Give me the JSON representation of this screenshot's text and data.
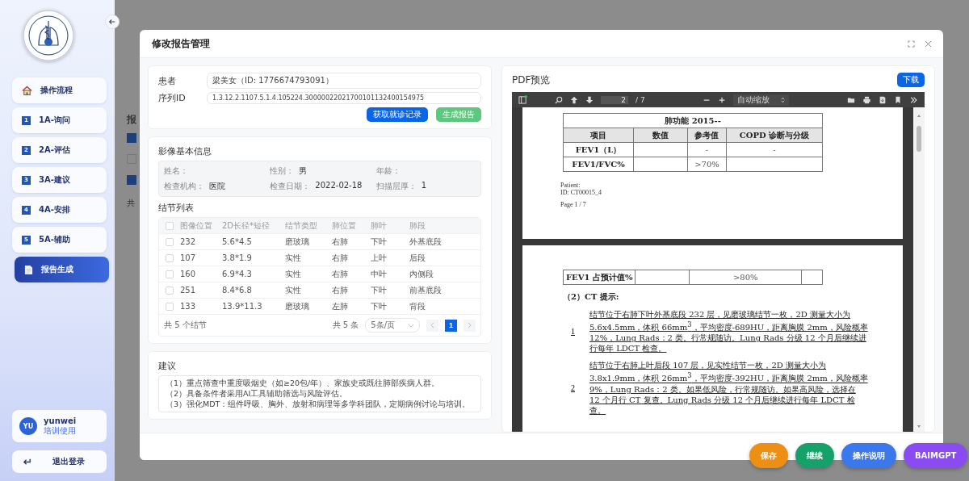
{
  "sidebar": {
    "nav": [
      {
        "kind": "home",
        "label": "操作流程",
        "selected": false
      },
      {
        "kind": "step",
        "badge": "1",
        "label": "1A-询问",
        "selected": false
      },
      {
        "kind": "step",
        "badge": "2",
        "label": "2A-评估",
        "selected": false
      },
      {
        "kind": "step",
        "badge": "3",
        "label": "3A-建议",
        "selected": false
      },
      {
        "kind": "step",
        "badge": "4",
        "label": "4A-安排",
        "selected": false
      },
      {
        "kind": "step",
        "badge": "5",
        "label": "5A-辅助",
        "selected": false
      },
      {
        "kind": "doc",
        "label": "报告生成",
        "selected": true
      }
    ],
    "user": {
      "avatar": "YU",
      "name": "yunwei",
      "role": "培训使用"
    },
    "logout": "退出登录"
  },
  "background": {
    "heading": "报",
    "footer": "共",
    "checkboxes": [
      {
        "checked": true
      },
      {
        "checked": false
      },
      {
        "checked": true
      }
    ]
  },
  "modal": {
    "title": "修改报告管理",
    "patient": {
      "label": "患者",
      "value": "梁美女（ID: 1776674793091）"
    },
    "series": {
      "label": "序列ID",
      "value": "1.3.12.2.1107.5.1.4.105224.30000022021700101132400154975"
    },
    "actions": [
      {
        "kind": "primary",
        "label": "获取就诊记录"
      },
      {
        "kind": "success",
        "label": "生成报告"
      }
    ],
    "image_info": {
      "title": "影像基本信息",
      "fields": [
        {
          "label": "姓名："
        },
        {
          "label": "性别：",
          "value": "男"
        },
        {
          "label": "年龄："
        },
        {
          "label": "检查机构：",
          "value": "医院"
        },
        {
          "label": "检查日期：",
          "value": "2022-02-18"
        },
        {
          "label": "扫描层厚：",
          "value": "1"
        }
      ]
    },
    "nodules": {
      "title": "结节列表",
      "header_checked": false,
      "columns": [
        "图像位置",
        "2D长径*短径",
        "结节类型",
        "肺位置",
        "肺叶",
        "肺段"
      ],
      "rows": [
        {
          "checked": false,
          "cells": [
            "232",
            "5.6*4.5",
            "磨玻璃",
            "右肺",
            "下叶",
            "外基底段"
          ]
        },
        {
          "checked": false,
          "cells": [
            "107",
            "3.8*1.9",
            "实性",
            "右肺",
            "上叶",
            "后段"
          ]
        },
        {
          "checked": false,
          "cells": [
            "160",
            "6.9*4.3",
            "实性",
            "右肺",
            "中叶",
            "内侧段"
          ]
        },
        {
          "checked": false,
          "cells": [
            "251",
            "8.4*6.8",
            "实性",
            "右肺",
            "下叶",
            "前基底段"
          ]
        },
        {
          "checked": false,
          "cells": [
            "133",
            "13.9*11.3",
            "磨玻璃",
            "左肺",
            "下叶",
            "背段"
          ]
        }
      ],
      "summary": "共 5 个结节",
      "total": "共 5 条",
      "page_size": "5条/页",
      "pages": [
        {
          "label": "1",
          "selected": true
        }
      ]
    },
    "advice": {
      "title": "建议",
      "lines": [
        "（1）重点筛查中重度吸烟史（如≥20包/年）、家族史或既往肺部疾病人群。",
        "（2）具备条件者采用AI工具辅助筛选与风险评估。",
        "（3）强化MDT：组件呼吸、胸外、放射和病理等多学科团队，定期病例讨论与培训。"
      ]
    },
    "pdf": {
      "title": "PDF预览",
      "download": "下载",
      "page_input": "2",
      "page_count": "/ 7",
      "zoom": "自动缩放",
      "page1": {
        "table_title": "肺功能 2015--",
        "headers": [
          "项目",
          "数值",
          "参考值",
          "COPD 诊断与分级"
        ],
        "rows": [
          [
            "FEV1（L）",
            null,
            "-",
            "-"
          ],
          [
            "FEV1/FVC%",
            null,
            ">70%",
            null
          ]
        ],
        "footer": [
          "Patient:",
          "ID: CT00015_4"
        ],
        "page_label": "Page 1 / 7"
      },
      "page2": {
        "rows": [
          [
            "FEV1 占预计值%",
            null,
            ">80%",
            null
          ]
        ],
        "heading": "（2）CT 提示:",
        "items": [
          {
            "num": "1",
            "text": "结节位于右肺下叶外基底段 232 层，见磨玻璃结节一枚，2D 测量大小为 5.6x4.5mm，体积 66mm$^{3}$，平均密度-689HU，距离胸膜 2mm，风险概率 12%，Lung Rads：2 类。行常规随访。Lung Rads 分级 12 个月后继续进行每年 LDCT 检查。"
          },
          {
            "num": "2",
            "text": "结节位于右肺上叶后段 107 层，见实性结节一枚，2D 测量大小为 3.8x1.9mm，体积 26mm$^{3}$，平均密度-392HU，距离胸膜 2mm，风险概率 9%，Lung Rads：2 类。如果低风险，行常规随访。如果高风险，选择在 12 个月行 CT 复查。Lung Rads 分级 12 个月后继续进行每年 LDCT 检查。"
          }
        ]
      }
    }
  },
  "floating_buttons": [
    {
      "label": "保存",
      "color": "#ec8f14"
    },
    {
      "label": "继续",
      "color": "#16a06a"
    },
    {
      "label": "操作说明",
      "color": "#3a78ec"
    },
    {
      "label": "BAIMGPT",
      "color": "#8a4cf0"
    }
  ]
}
